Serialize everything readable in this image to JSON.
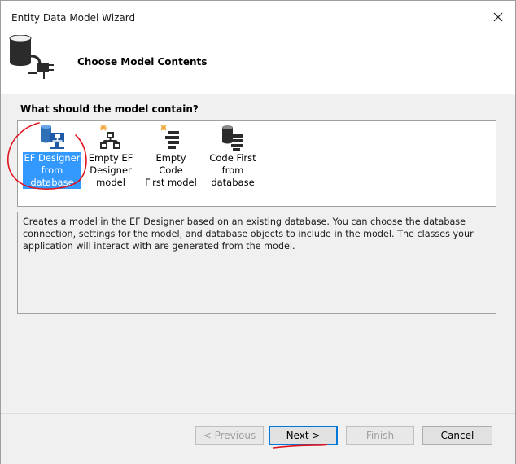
{
  "window": {
    "title": "Entity Data Model Wizard"
  },
  "header": {
    "title": "Choose Model Contents",
    "icon": "database-plug-icon"
  },
  "main": {
    "question": "What should the model contain?",
    "options": [
      {
        "lines": [
          "EF Designer",
          "from",
          "database"
        ],
        "icon": "ef-designer-from-database-icon",
        "selected": true
      },
      {
        "lines": [
          "Empty EF",
          "Designer",
          "model"
        ],
        "icon": "empty-ef-designer-icon",
        "selected": false
      },
      {
        "lines": [
          "Empty Code",
          "First model"
        ],
        "icon": "empty-code-first-icon",
        "selected": false
      },
      {
        "lines": [
          "Code First",
          "from",
          "database"
        ],
        "icon": "code-first-from-database-icon",
        "selected": false
      }
    ],
    "description": "Creates a model in the EF Designer based on an existing database. You can choose the database connection, settings for the model, and database objects to include in the model. The classes your application will interact with are generated from the model."
  },
  "footer": {
    "previous_label": "< Previous",
    "next_label": "Next >",
    "finish_label": "Finish",
    "cancel_label": "Cancel"
  },
  "colors": {
    "selection": "#3399ff",
    "annotation": "#e0141e",
    "default_button_border": "#0078d7"
  }
}
